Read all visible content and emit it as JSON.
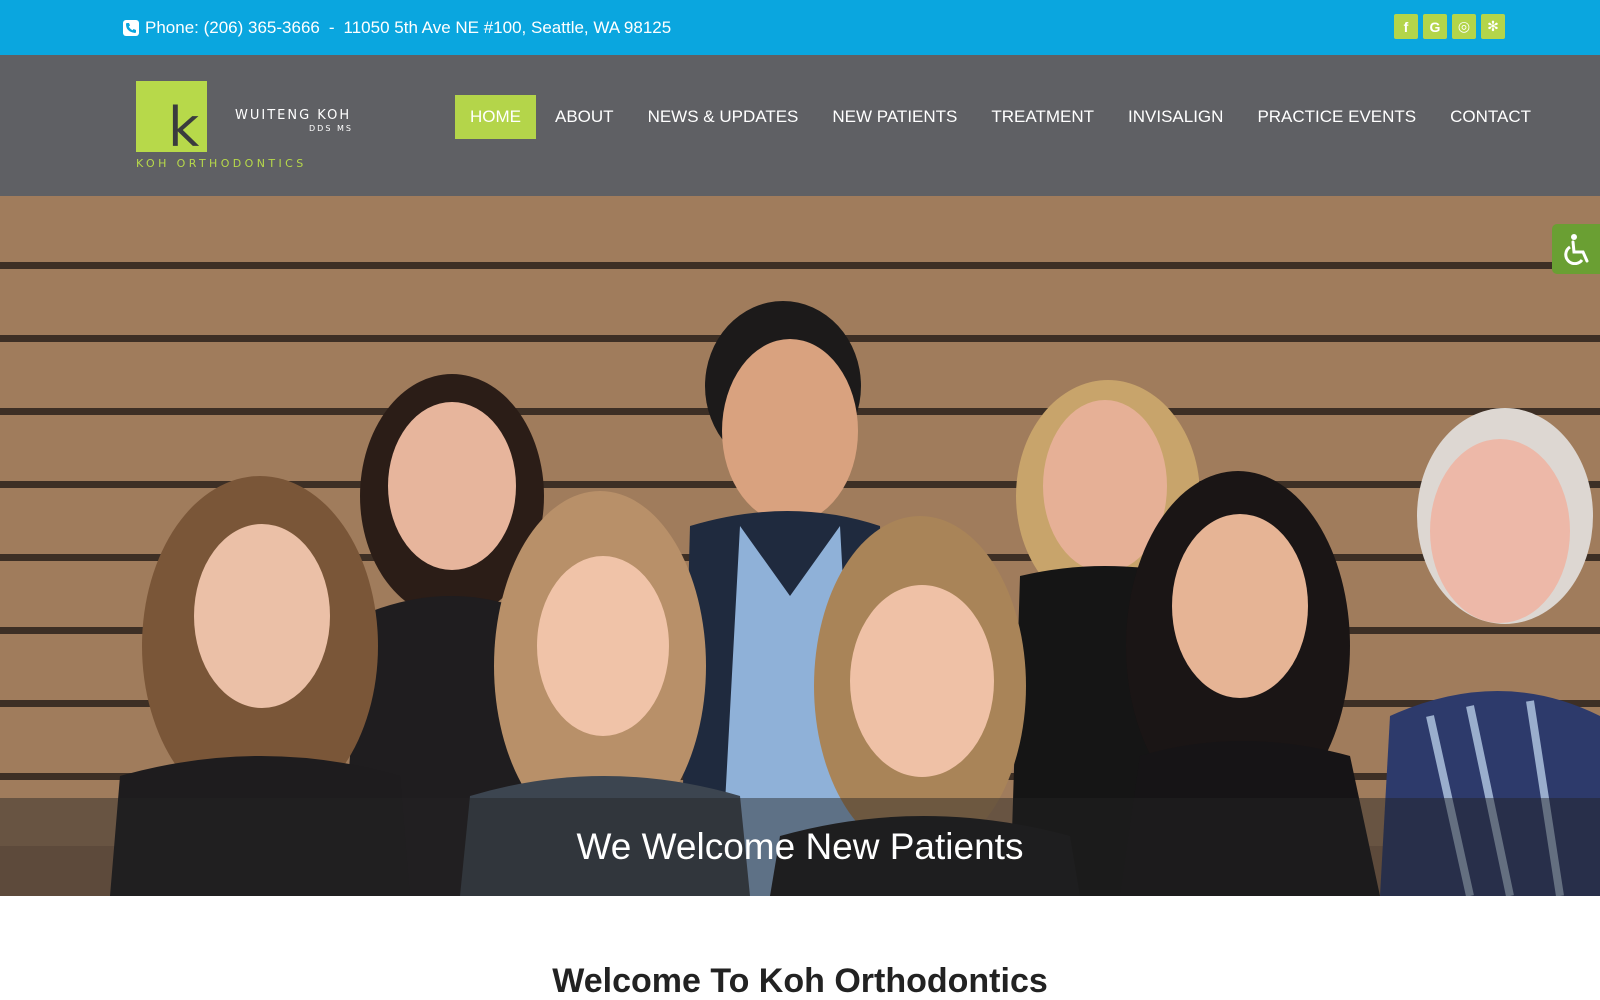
{
  "topbar": {
    "phone": "Phone: (206) 365-3666",
    "separator": "-",
    "address": "11050 5th Ave NE #100, Seattle, WA 98125",
    "social": [
      {
        "icon": "facebook-icon",
        "glyph": "f"
      },
      {
        "icon": "google-icon",
        "glyph": "G"
      },
      {
        "icon": "instagram-icon",
        "glyph": "◎"
      },
      {
        "icon": "yelp-icon",
        "glyph": "✻"
      }
    ]
  },
  "logo": {
    "mark": "k",
    "name": "WUITENG KOH",
    "credentials": "DDS MS",
    "practice": "KOH ORTHODONTICS"
  },
  "nav": {
    "items": [
      "HOME",
      "ABOUT",
      "NEWS & UPDATES",
      "NEW PATIENTS",
      "TREATMENT",
      "INVISALIGN",
      "PRACTICE EVENTS",
      "CONTACT"
    ],
    "active": "HOME"
  },
  "hero": {
    "caption": "We Welcome New Patients"
  },
  "main": {
    "heading": "Welcome To Koh Orthodontics"
  },
  "colors": {
    "topbar": "#0aa6df",
    "header": "#5f6064",
    "accent": "#b4d54a",
    "accessibility": "#6a9f33"
  }
}
